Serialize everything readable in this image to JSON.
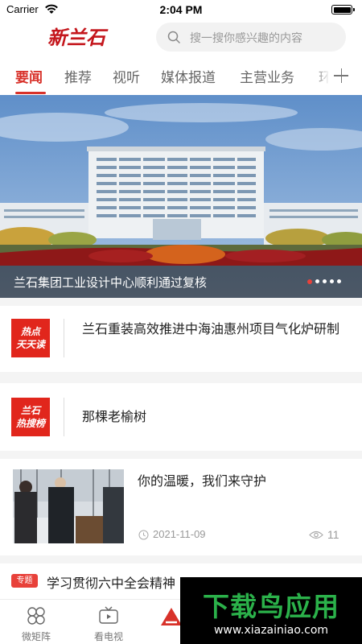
{
  "status_bar": {
    "carrier": "Carrier",
    "time": "2:04 PM",
    "wifi_icon": "wifi-icon",
    "battery_icon": "battery-icon"
  },
  "header": {
    "logo_text": "新兰石",
    "search_placeholder": "搜一搜你感兴趣的内容",
    "search_icon": "search-icon"
  },
  "tabs": {
    "items": [
      {
        "label": "要闻",
        "active": true
      },
      {
        "label": "推荐",
        "active": false
      },
      {
        "label": "视听",
        "active": false
      },
      {
        "label": "媒体报道",
        "active": false
      },
      {
        "label": "主营业务",
        "active": false
      },
      {
        "label": "环",
        "active": false
      }
    ],
    "add_icon": "plus-icon"
  },
  "banner": {
    "caption": "兰石集团工业设计中心顺利通过复核",
    "slide_count": 5,
    "active_slide": 1
  },
  "news": [
    {
      "badge": [
        "热点",
        "天天读"
      ],
      "title": "兰石重装高效推进中海油惠州项目气化炉研制"
    },
    {
      "badge": [
        "兰石",
        "热搜榜"
      ],
      "title": "那棵老榆树"
    }
  ],
  "photo_news": {
    "title": "你的温暖，我们来守护",
    "date": "2021-11-09",
    "views": "11"
  },
  "special": {
    "tag": "专题",
    "title": "学习贯彻六中全会精神"
  },
  "bottom_nav": [
    {
      "label": "微矩阵",
      "icon": "grid-icon"
    },
    {
      "label": "看电视",
      "icon": "tv-icon"
    },
    {
      "label": "",
      "icon": "home-logo-icon"
    }
  ],
  "watermark": {
    "title": "下载鸟应用",
    "url": "www.xiazainiao.com"
  },
  "colors": {
    "accent": "#d8322a",
    "badge": "#e1261c",
    "watermark_green": "#2bb14a"
  }
}
